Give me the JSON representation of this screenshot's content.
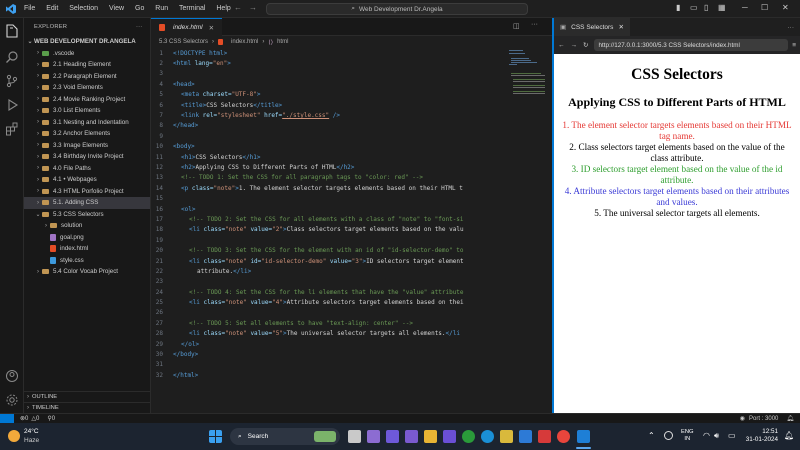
{
  "titlebar": {
    "menu": [
      "File",
      "Edit",
      "Selection",
      "View",
      "Go",
      "Run",
      "Terminal",
      "Help"
    ],
    "search_text": "Web Development Dr.Angela"
  },
  "sidebar": {
    "header": "EXPLORER",
    "root": "WEB DEVELOPMENT DR.ANGELA",
    "items": [
      {
        "label": ".vscode",
        "type": "folder"
      },
      {
        "label": "2.1 Heading Element",
        "type": "folder"
      },
      {
        "label": "2.2 Paragraph Element",
        "type": "folder"
      },
      {
        "label": "2.3 Void Elements",
        "type": "folder"
      },
      {
        "label": "2.4 Movie Ranking Project",
        "type": "folder"
      },
      {
        "label": "3.0 List Elements",
        "type": "folder"
      },
      {
        "label": "3.1 Nesting and Indentation",
        "type": "folder"
      },
      {
        "label": "3.2 Anchor Elements",
        "type": "folder"
      },
      {
        "label": "3.3 Image Elements",
        "type": "folder"
      },
      {
        "label": "3.4 Birthday Invite Project",
        "type": "folder"
      },
      {
        "label": "4.0 File Paths",
        "type": "folder"
      },
      {
        "label": "4.1 • Webpages",
        "type": "folder"
      },
      {
        "label": "4.3 HTML Porfolio Project",
        "type": "folder"
      },
      {
        "label": "5.1. Adding CSS",
        "type": "folder",
        "selected": true
      },
      {
        "label": "5.3 CSS Selectors",
        "type": "folder-open"
      },
      {
        "label": "solution",
        "type": "folder"
      },
      {
        "label": "goal.png",
        "type": "image"
      },
      {
        "label": "index.html",
        "type": "html"
      },
      {
        "label": "style.css",
        "type": "css"
      },
      {
        "label": "5.4 Color Vocab Project",
        "type": "folder"
      }
    ],
    "outline": "OUTLINE",
    "timeline": "TIMELINE"
  },
  "editor": {
    "tab_label": "index.html",
    "breadcrumb": [
      "5.3 CSS Selectors",
      "index.html",
      "html"
    ],
    "lines": [
      "1",
      "2",
      "3",
      "4",
      "5",
      "6",
      "7",
      "8",
      "9",
      "10",
      "11",
      "12",
      "13",
      "14",
      "15",
      "16",
      "17",
      "18",
      "19",
      "20",
      "21",
      "22",
      "23",
      "24",
      "25",
      "26",
      "27",
      "28",
      "29",
      "30",
      "31",
      "32"
    ],
    "code": {
      "l1": "<!DOCTYPE html>",
      "l2a": "<html",
      "l2b": " lang=",
      "l2c": "\"en\"",
      "l2d": ">",
      "l4": "<head>",
      "l5a": "<meta",
      "l5b": " charset=",
      "l5c": "\"UTF-8\"",
      "l5d": ">",
      "l6a": "<title>",
      "l6b": "CSS Selectors",
      "l6c": "</title>",
      "l7a": "<link",
      "l7b": " rel=",
      "l7c": "\"stylesheet\"",
      "l7d": " href=",
      "l7e": "\"./style.css\"",
      "l7f": " />",
      "l8": "</head>",
      "l10": "<body>",
      "l11a": "<h1>",
      "l11b": "CSS Selectors",
      "l11c": "</h1>",
      "l12a": "<h2>",
      "l12b": "Applying CSS to Different Parts of HTML",
      "l12c": "</h2>",
      "l13": "<!-- TODO 1: Set the CSS for all paragraph tags to \"color: red\" -->",
      "l14a": "<p",
      "l14b": " class=",
      "l14c": "\"note\"",
      "l14d": ">",
      "l14e": "1. The element selector targets elements based on their HTML t",
      "l16": "<ol>",
      "l17": "<!-- TODO 2: Set the CSS for all elements with a class of \"note\" to \"font-si",
      "l18a": "<li",
      "l18b": " class=",
      "l18c": "\"note\"",
      "l18d": " value=",
      "l18e": "\"2\"",
      "l18f": ">",
      "l18g": "Class selectors target elements based on the valu",
      "l20": "<!-- TODO 3: Set the CSS for the element with an id of \"id-selector-demo\" to",
      "l21a": "<li",
      "l21b": " class=",
      "l21c": "\"note\"",
      "l21d": " id=",
      "l21e": "\"id-selector-demo\"",
      "l21f": " value=",
      "l21g": "\"3\"",
      "l21h": ">",
      "l21i": "ID selectors target element",
      "l22a": "attribute.",
      "l22b": "</li>",
      "l24": "<!-- TODO 4: Set the CSS for the li elements that have the \"value\" attribute",
      "l25a": "<li",
      "l25b": " class=",
      "l25c": "\"note\"",
      "l25d": " value=",
      "l25e": "\"4\"",
      "l25f": ">",
      "l25g": "Attribute selectors target elements based on thei",
      "l27": "<!-- TODO 5: Set all elements to have \"text-align: center\" -->",
      "l28a": "<li",
      "l28b": " class=",
      "l28c": "\"note\"",
      "l28d": " value=",
      "l28e": "\"5\"",
      "l28f": ">",
      "l28g": "The universal selector targets all elements.",
      "l28h": "</li",
      "l29": "</ol>",
      "l30": "</body>",
      "l32": "</html>"
    }
  },
  "browser": {
    "tab_label": "CSS Selectors",
    "url": "http://127.0.0.1:3000/5.3 CSS Selectors/index.html",
    "h1": "CSS Selectors",
    "h2": "Applying CSS to Different Parts of HTML",
    "items": [
      {
        "text": "1. The element selector targets elements based on their HTML tag name.",
        "color": "#e53935"
      },
      {
        "text": "2. Class selectors target elements based on the value of the class attribute.",
        "color": "#000000"
      },
      {
        "text": "3. ID selectors target element based on the value of the id attribute.",
        "color": "#2e9e2e"
      },
      {
        "text": "4. Attribute selectors target elements based on their attributes and values.",
        "color": "#3b3bd6"
      },
      {
        "text": "5. The universal selector targets all elements.",
        "color": "#000000"
      }
    ]
  },
  "statusbar": {
    "errors": "0",
    "warnings": "0",
    "ports": "0",
    "port_text": "Port : 3000"
  },
  "taskbar": {
    "weather_temp": "24°C",
    "weather_desc": "Haze",
    "search_placeholder": "Search",
    "lang_top": "ENG",
    "lang_bottom": "IN",
    "time": "12:51",
    "date": "31-01-2024"
  }
}
